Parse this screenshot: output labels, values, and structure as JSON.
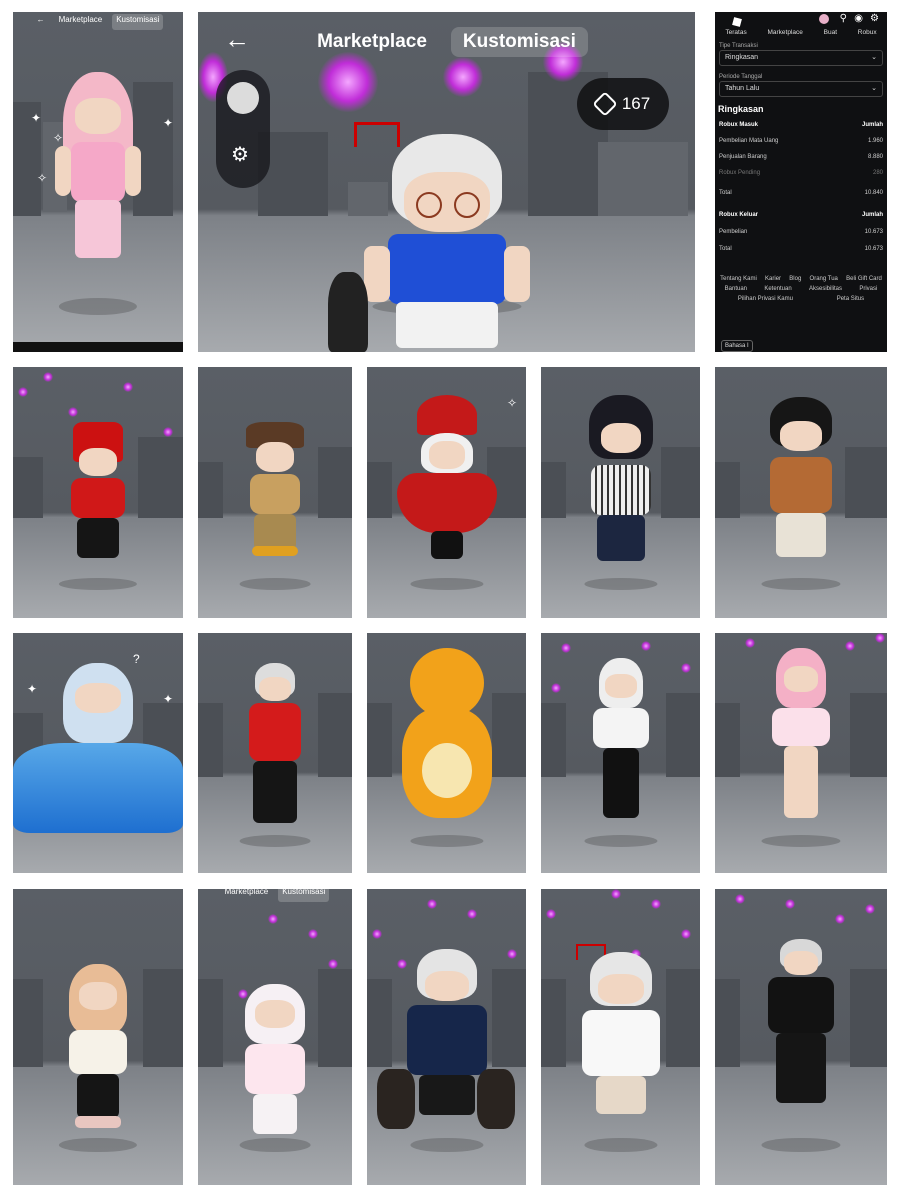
{
  "big_view": {
    "tabs": [
      "Marketplace",
      "Kustomisasi"
    ],
    "active_tab": "Kustomisasi",
    "robux_balance": "167",
    "back_icon": "arrow-left-icon"
  },
  "small_view": {
    "tabs": [
      "Marketplace",
      "Kustomisasi"
    ],
    "active_tab": "Kustomisasi"
  },
  "last_row_second_tile_bar": {
    "tabs": [
      "Marketplace",
      "Kustomisasi"
    ]
  },
  "transactions_panel": {
    "nav": [
      "Teratas",
      "Marketplace",
      "Buat",
      "Robux"
    ],
    "type_label": "Tipe Transaksi",
    "type_value": "Ringkasan",
    "period_label": "Periode Tanggal",
    "period_value": "Tahun Lalu",
    "summary_title": "Ringkasan",
    "incoming": {
      "header": "Robux Masuk",
      "amount_header": "Jumlah",
      "rows": [
        {
          "label": "Pembelian Mata Uang",
          "value": "1.960"
        },
        {
          "label": "Penjualan Barang",
          "value": "8.880"
        },
        {
          "label": "Robux Pending",
          "value": "280"
        },
        {
          "label": "Total",
          "value": "10.840"
        }
      ]
    },
    "outgoing": {
      "header": "Robux Keluar",
      "amount_header": "Jumlah",
      "rows": [
        {
          "label": "Pembelian",
          "value": "10.673"
        },
        {
          "label": "Total",
          "value": "10.673"
        }
      ]
    },
    "footer_links": [
      "Tentang Kami",
      "Karier",
      "Blog",
      "Orang Tua",
      "Beli Gift Card",
      "Bantuan",
      "Ketentuan",
      "Aksesibilitas",
      "Privasi",
      "Pilihan Privasi Kamu",
      "Peta Situs"
    ],
    "language_button": "Bahasa I"
  },
  "colors": {
    "sparkle": "#c02dd8",
    "panel_bg": "#0f1012",
    "scene_bg": "#5a5f66"
  }
}
